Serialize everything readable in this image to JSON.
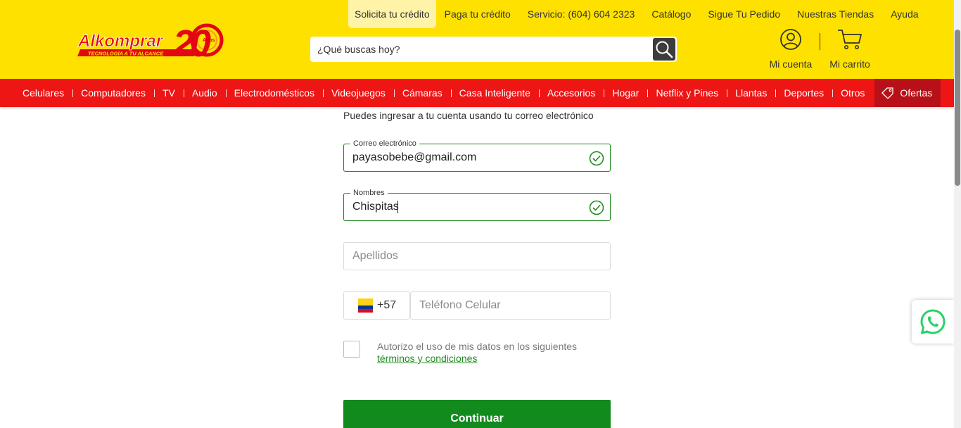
{
  "header": {
    "top_links": [
      "Solicita tu crédito",
      "Paga tu crédito",
      "Servicio: (604) 604 2323",
      "Catálogo",
      "Sigue Tu Pedido",
      "Nuestras Tiendas",
      "Ayuda"
    ],
    "logo": {
      "brand": "Alkomprar",
      "tagline": "TECNOLOGÍA A TU ALCANCE",
      "anniversary_number": "20",
      "anniversary_word": "Años"
    },
    "search": {
      "placeholder": "¿Qué buscas hoy?",
      "icon": "search-icon"
    },
    "account_label": "Mi cuenta",
    "cart_label": "Mi carrito"
  },
  "nav": {
    "items": [
      "Celulares",
      "Computadores",
      "TV",
      "Audio",
      "Electrodomésticos",
      "Videojuegos",
      "Cámaras",
      "Casa Inteligente",
      "Accesorios",
      "Hogar",
      "Netflix y Pines",
      "Llantas",
      "Deportes",
      "Otros"
    ],
    "offers_label": "Ofertas"
  },
  "form": {
    "intro": "Puedes ingresar a tu cuenta usando tu correo electrónico",
    "email": {
      "label": "Correo electrónico",
      "value": "payasobebe@gmail.com",
      "valid": true
    },
    "first_name": {
      "label": "Nombres",
      "value": "Chispitas",
      "valid": true
    },
    "last_name": {
      "placeholder": "Apellidos"
    },
    "phone": {
      "country_code": "+57",
      "flag": "colombia-flag",
      "placeholder": "Teléfono Celular"
    },
    "consent": {
      "text": "Autorizo el uso de mis datos en los siguientes",
      "link": "términos y condiciones",
      "checked": false
    },
    "submit_label": "Continuar"
  },
  "colors": {
    "header_yellow": "#ffe100",
    "nav_red": "#ee1515",
    "offers_red": "#b81018",
    "valid_green": "#1d8a1d",
    "button_green": "#138a1e",
    "whatsapp_green": "#25d366"
  }
}
